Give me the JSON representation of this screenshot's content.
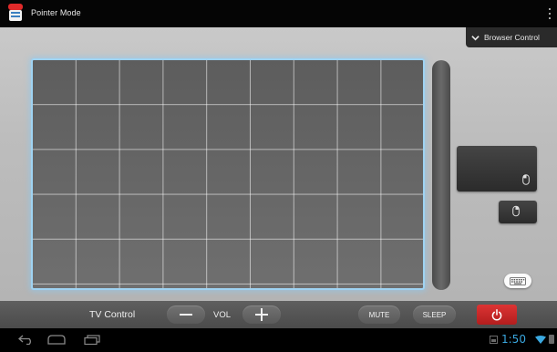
{
  "app": {
    "title": "Pointer Mode"
  },
  "browser_control": {
    "label": "Browser Control"
  },
  "tv_control": {
    "label": "TV Control",
    "vol_minus": "—",
    "vol_label": "VOL",
    "vol_plus": "+",
    "mute": "MUTE",
    "sleep": "SLEEP"
  },
  "status": {
    "time": "1:50"
  },
  "colors": {
    "accent": "#3aa8e0",
    "power": "#c62828",
    "touchpad_glow": "#9fd3f2"
  },
  "icons": {
    "app": "remote-icon",
    "overflow": "overflow-menu-icon",
    "chevron": "chevron-down-icon",
    "mouse": "mouse-icon",
    "keyboard": "keyboard-icon",
    "power": "power-icon",
    "back": "back-icon",
    "home": "home-icon",
    "recents": "recents-icon"
  }
}
